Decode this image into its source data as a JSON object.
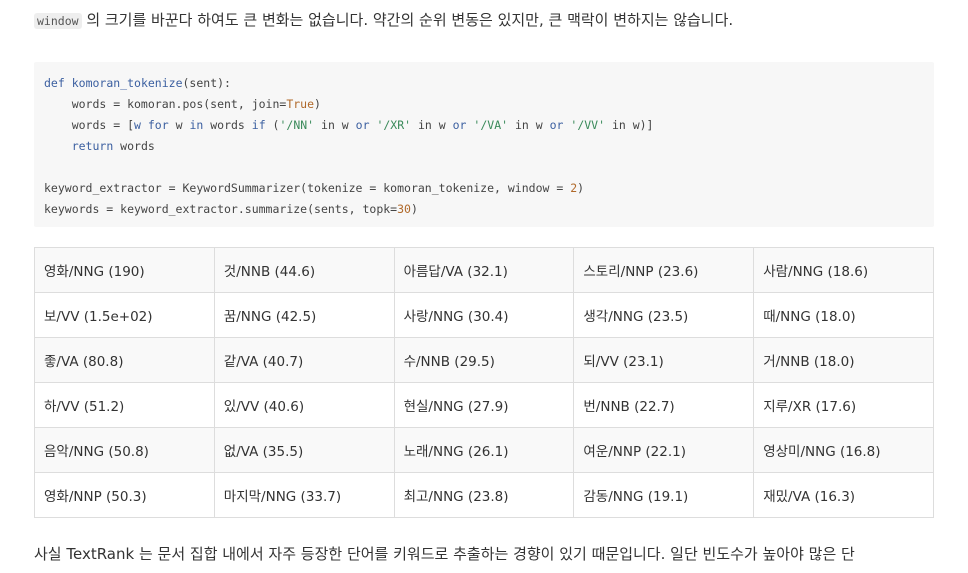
{
  "intro": {
    "code_term": "window",
    "text": " 의 크기를 바꾼다 하여도 큰 변화는 없습니다. 약간의 순위 변동은 있지만, 큰 맥락이 변하지는 않습니다."
  },
  "code": {
    "def": "def",
    "func_name": "komoran_tokenize",
    "def_args": "(sent):",
    "l2_a": "    words = komoran.pos(sent, join=",
    "l2_true": "True",
    "l2_b": ")",
    "l3_a": "    words = [",
    "l3_w": "w",
    "l3_for": " for ",
    "l3_b": "w ",
    "l3_in": "in",
    "l3_c": " words ",
    "l3_if": "if",
    "l3_d": " (",
    "s_nn": "'/NN'",
    "s_xr": "'/XR'",
    "s_va": "'/VA'",
    "s_vv": "'/VV'",
    "in_w": " in w ",
    "or": "or",
    "l3_end": " in w)]",
    "return": "return",
    "return_val": " words",
    "l5": "keyword_extractor = KeywordSummarizer(tokenize = komoran_tokenize, window = ",
    "l5_num": "2",
    "l5_end": ")",
    "l6": "keywords = keyword_extractor.summarize(sents, topk=",
    "l6_num": "30",
    "l6_end": ")"
  },
  "keywords_table": {
    "rows": [
      [
        "영화/NNG (190)",
        "것/NNB (44.6)",
        "아름답/VA (32.1)",
        "스토리/NNP (23.6)",
        "사람/NNG (18.6)"
      ],
      [
        "보/VV (1.5e+02)",
        "꿈/NNG (42.5)",
        "사랑/NNG (30.4)",
        "생각/NNG (23.5)",
        "때/NNG (18.0)"
      ],
      [
        "좋/VA (80.8)",
        "같/VA (40.7)",
        "수/NNB (29.5)",
        "되/VV (23.1)",
        "거/NNB (18.0)"
      ],
      [
        "하/VV (51.2)",
        "있/VV (40.6)",
        "현실/NNG (27.9)",
        "번/NNB (22.7)",
        "지루/XR (17.6)"
      ],
      [
        "음악/NNG (50.8)",
        "없/VA (35.5)",
        "노래/NNG (26.1)",
        "여운/NNP (22.1)",
        "영상미/NNG (16.8)"
      ],
      [
        "영화/NNP (50.3)",
        "마지막/NNG (33.7)",
        "최고/NNG (23.8)",
        "감동/NNG (19.1)",
        "재밌/VA (16.3)"
      ]
    ]
  },
  "outro": {
    "text": "사실 TextRank 는 문서 집합 내에서 자주 등장한 단어를 키워드로 추출하는 경향이 있기 때문입니다. 일단 빈도수가 높아야 많은 단"
  }
}
